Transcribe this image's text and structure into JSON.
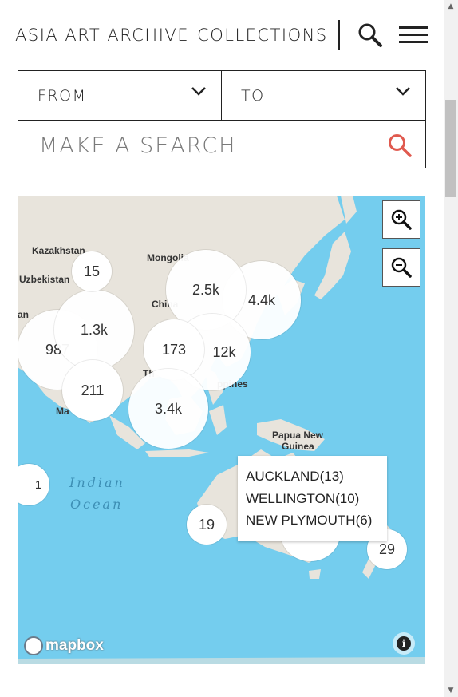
{
  "header": {
    "brand_primary": "ASIA ART ARCHIVE",
    "brand_secondary": "COLLECTIONS",
    "search_icon": "search-icon",
    "menu_icon": "hamburger-menu-icon"
  },
  "filters": {
    "from_label": "FROM",
    "to_label": "TO",
    "search_placeholder": "MAKE A SEARCH",
    "search_value": "",
    "accent_color": "#e05a4f"
  },
  "map": {
    "ocean_color": "#74cdee",
    "land_color": "#e8e4dc",
    "place_labels": [
      "Kazakhstan",
      "Mongolia",
      "Uzbekistan",
      "China",
      "Papua New",
      "Guinea",
      "ppines",
      "Ma",
      "Th",
      "an"
    ],
    "ocean_label_line1": "Indian",
    "ocean_label_line2": "Ocean",
    "clusters": [
      {
        "id": "c15",
        "count": "15"
      },
      {
        "id": "c2500",
        "count": "2.5k"
      },
      {
        "id": "c4400",
        "count": "4.4k"
      },
      {
        "id": "c1300",
        "count": "1.3k"
      },
      {
        "id": "c987",
        "count": "987"
      },
      {
        "id": "c173",
        "count": "173"
      },
      {
        "id": "c12k",
        "count": "12k"
      },
      {
        "id": "c211",
        "count": "211"
      },
      {
        "id": "c3400",
        "count": "3.4k"
      },
      {
        "id": "c1",
        "count": "1"
      },
      {
        "id": "c19",
        "count": "19"
      },
      {
        "id": "c29",
        "count": "29"
      }
    ],
    "popup_rows": [
      "AUCKLAND(13)",
      "WELLINGTON(10)",
      "NEW PLYMOUTH(6)"
    ],
    "zoom_in_icon": "zoom-in-icon",
    "zoom_out_icon": "zoom-out-icon",
    "attribution_logo": "mapbox",
    "info_icon": "info-icon"
  }
}
